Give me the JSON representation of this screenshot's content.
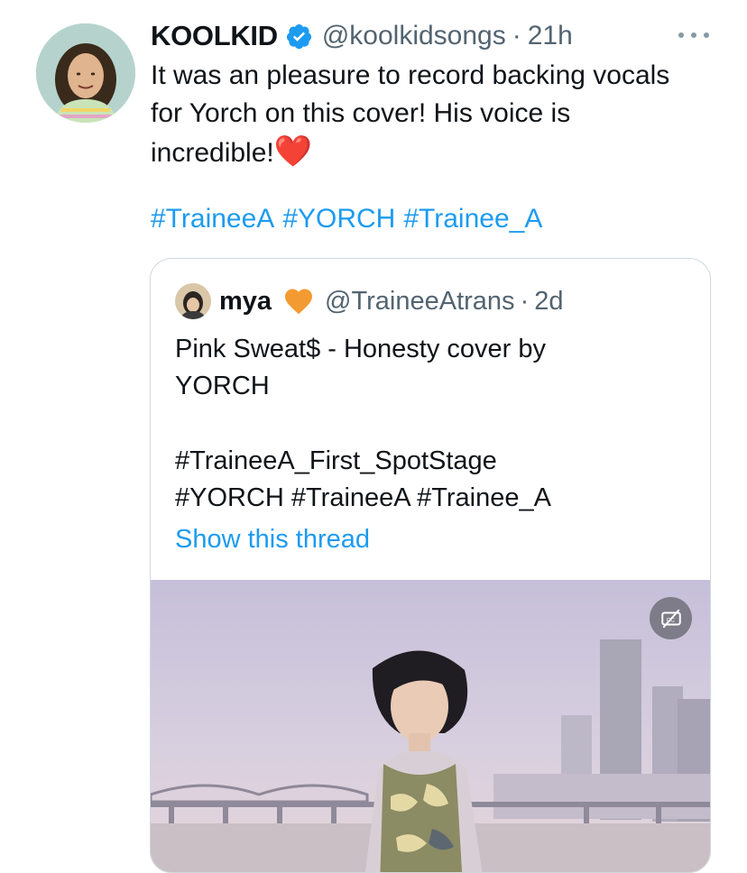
{
  "tweet": {
    "display_name": "KOOLKID",
    "handle": "@koolkidsongs",
    "separator": "·",
    "time": "21h",
    "text_line1": "It was an pleasure to record backing vocals",
    "text_line2": "for Yorch on this cover! His voice is",
    "text_line3": "incredible!",
    "text_emoji": "❤️",
    "hashtags": [
      "#TraineeA",
      "#YORCH",
      "#Trainee_A"
    ],
    "more_icon": "more-horizontal-icon",
    "verified_icon": "verified-badge-icon"
  },
  "quoted": {
    "display_name": "mya",
    "name_emoji_icon": "orange-heart-icon",
    "handle": "@TraineeAtrans",
    "separator": "·",
    "time": "2d",
    "text_line1": "Pink Sweat$ - Honesty cover by",
    "text_line2": "YORCH",
    "tags_line1": "#TraineeA_First_SpotStage",
    "tags_line2": "#YORCH #TraineeA #Trainee_A",
    "show_thread": "Show this thread",
    "captions_icon": "captions-off-icon"
  },
  "colors": {
    "link": "#1d9bf0",
    "secondary_text": "#536471",
    "border": "#cfd9de",
    "verified": "#1d9bf0"
  }
}
